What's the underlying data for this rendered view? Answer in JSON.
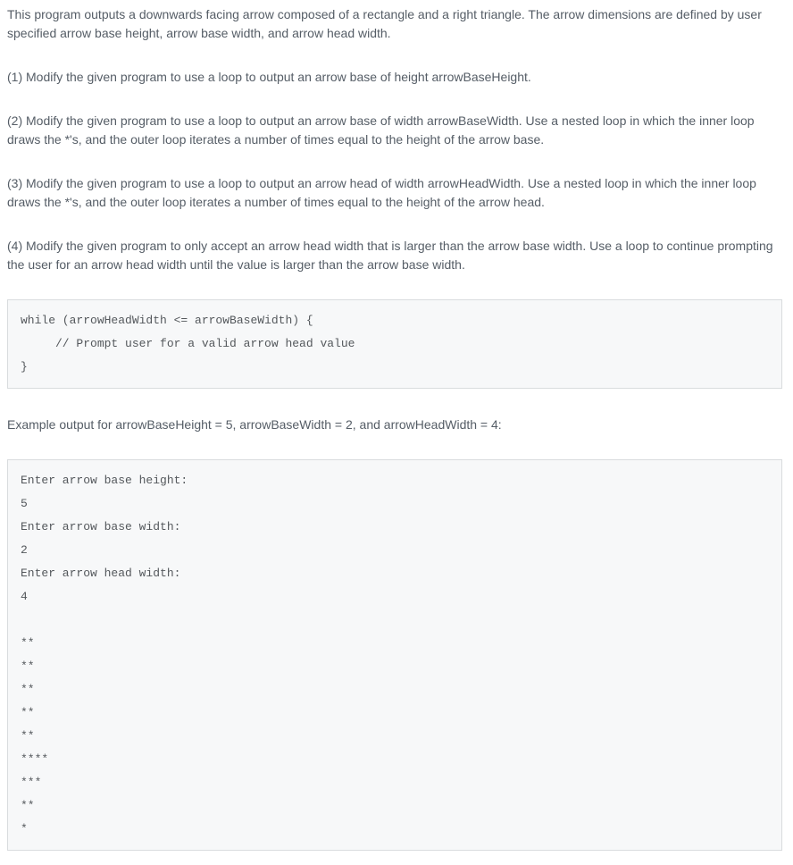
{
  "intro": "This program outputs a downwards facing arrow composed of a rectangle and a right triangle. The arrow dimensions are defined by user specified arrow base height, arrow base width, and arrow head width.",
  "step1": "(1) Modify the given program to use a loop to output an arrow base of height arrowBaseHeight.",
  "step2": "(2) Modify the given program to use a loop to output an arrow base of width arrowBaseWidth. Use a nested loop in which the inner loop draws the *'s, and the outer loop iterates a number of times equal to the height of the arrow base.",
  "step3": "(3) Modify the given program to use a loop to output an arrow head of width arrowHeadWidth. Use a nested loop in which the inner loop draws the *'s, and the outer loop iterates a number of times equal to the height of the arrow head.",
  "step4": "(4) Modify the given program to only accept an arrow head width that is larger than the arrow base width. Use a loop to continue prompting the user for an arrow head width until the value is larger than the arrow base width.",
  "code1": "while (arrowHeadWidth <= arrowBaseWidth) {\n     // Prompt user for a valid arrow head value\n}",
  "exampleLabel": "Example output for arrowBaseHeight = 5, arrowBaseWidth = 2, and arrowHeadWidth = 4:",
  "code2": "Enter arrow base height:\n5\nEnter arrow base width:\n2\nEnter arrow head width:\n4\n\n**\n**\n**\n**\n**\n****\n***\n**\n*"
}
